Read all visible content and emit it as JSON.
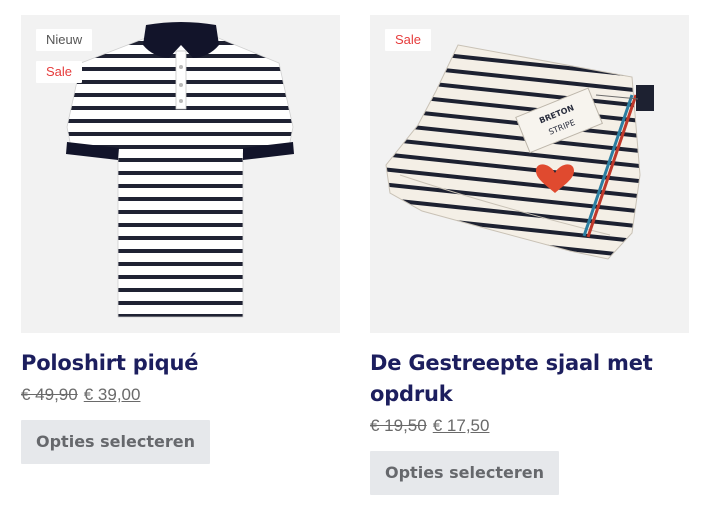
{
  "products": [
    {
      "badges": [
        "Nieuw",
        "Sale"
      ],
      "image_alt": "striped-polo-shirt",
      "title": "Poloshirt piqué",
      "old_price": "€ 49,90",
      "price": "€ 39,00",
      "button_label": "Opties selecteren"
    },
    {
      "badges": [
        "Sale"
      ],
      "image_alt": "striped-scarf-with-heart-print",
      "title": "De Gestreepte sjaal met opdruk",
      "old_price": "€ 19,50",
      "price": "€ 17,50",
      "button_label": "Opties selecteren"
    }
  ],
  "colors": {
    "title": "#1c1e5e",
    "sale": "#e63c3c",
    "button_bg": "#e6e8eb",
    "image_bg": "#f2f2f2"
  },
  "product_image_text": {
    "tag_brand": "BRETON",
    "tag_line": "STRIPE"
  }
}
